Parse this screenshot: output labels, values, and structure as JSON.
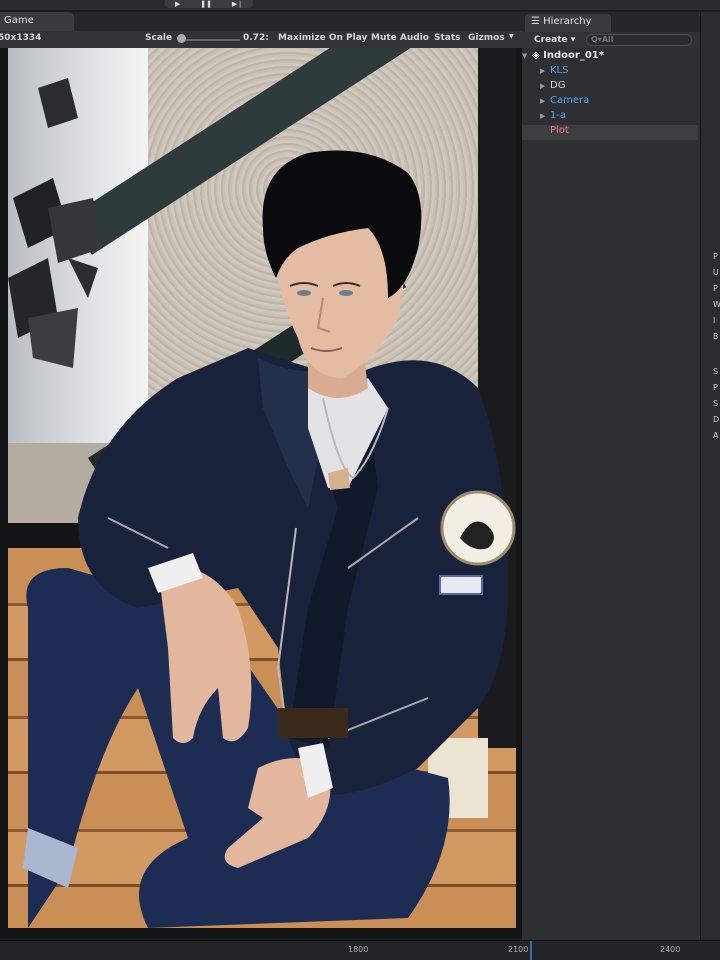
{
  "play_controls": {
    "play_icon": "play-icon",
    "pause_icon": "pause-icon",
    "step_icon": "step-icon"
  },
  "game": {
    "tab_label": "Game",
    "resolution": "50x1334",
    "scale_label": "Scale",
    "scale_value": "0.72:",
    "maximize_label": "Maximize On Play",
    "mute_label": "Mute Audio",
    "stats_label": "Stats",
    "gizmos_label": "Gizmos"
  },
  "hierarchy": {
    "tab_label": "Hierarchy",
    "create_label": "Create",
    "search_placeholder": "Q▾All",
    "scene_name": "Indoor_01*",
    "items": [
      {
        "label": "KLS",
        "color": "#5aa2ee"
      },
      {
        "label": "DG",
        "color": "#d4d4d4"
      },
      {
        "label": "Camera",
        "color": "#5aa2ee"
      },
      {
        "label": "1-a",
        "color": "#5aa2ee"
      },
      {
        "label": "Plot",
        "color": "#ef7a7a",
        "selected": true
      }
    ]
  },
  "timeline": {
    "ticks": [
      "1800",
      "2100",
      "2400"
    ]
  },
  "inspector_letters": [
    "P",
    "U",
    "P",
    "W",
    "I",
    "B",
    "S",
    "P",
    "S",
    "D",
    "A"
  ]
}
